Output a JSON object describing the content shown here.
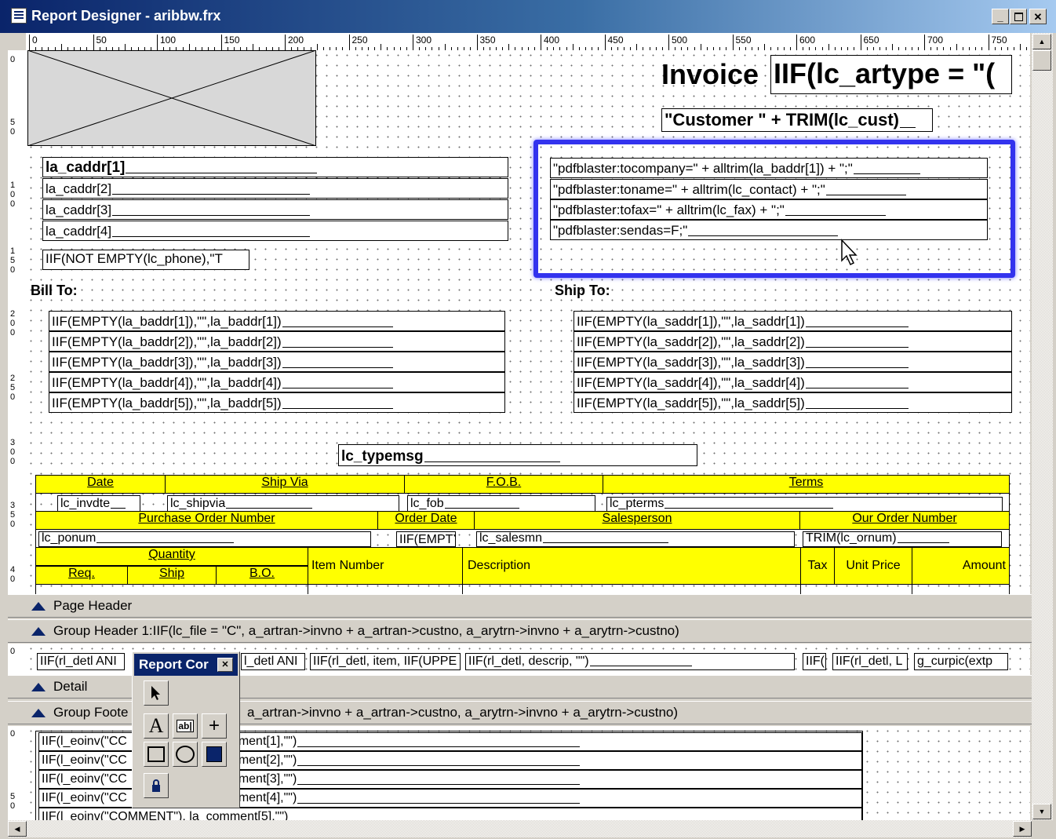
{
  "window": {
    "title": "Report Designer - aribbw.frx"
  },
  "ruler": {
    "labels": [
      "0",
      "50",
      "100",
      "150",
      "200",
      "250",
      "300",
      "350",
      "400",
      "450",
      "500",
      "550",
      "600",
      "650",
      "700",
      "750"
    ]
  },
  "header": {
    "invoice_label": "Invoice",
    "invoice_expr": "IIF(lc_artype = \"(",
    "customer_expr": "\"Customer \" + TRIM(lc_cust)"
  },
  "company_addr": [
    "la_caddr[1]",
    "la_caddr[2]",
    "la_caddr[3]",
    "la_caddr[4]"
  ],
  "phone_expr": "IIF(NOT EMPTY(lc_phone),\"T",
  "pdf_fields": [
    "\"pdfblaster:tocompany=\" + alltrim(la_baddr[1]) + \";\"",
    "\"pdfblaster:toname=\" + alltrim(lc_contact) + \";\"",
    "\"pdfblaster:tofax=\" + alltrim(lc_fax) + \";\"",
    "\"pdfblaster:sendas=F;\""
  ],
  "bill_to": {
    "label": "Bill To:",
    "lines": [
      "IIF(EMPTY(la_baddr[1]),\"\",la_baddr[1])",
      "IIF(EMPTY(la_baddr[2]),\"\",la_baddr[2])",
      "IIF(EMPTY(la_baddr[3]),\"\",la_baddr[3])",
      "IIF(EMPTY(la_baddr[4]),\"\",la_baddr[4])",
      "IIF(EMPTY(la_baddr[5]),\"\",la_baddr[5])"
    ]
  },
  "ship_to": {
    "label": "Ship To:",
    "lines": [
      "IIF(EMPTY(la_saddr[1]),\"\",la_saddr[1])",
      "IIF(EMPTY(la_saddr[2]),\"\",la_saddr[2])",
      "IIF(EMPTY(la_saddr[3]),\"\",la_saddr[3])",
      "IIF(EMPTY(la_saddr[4]),\"\",la_saddr[4])",
      "IIF(EMPTY(la_saddr[5]),\"\",la_saddr[5])"
    ]
  },
  "typemsg": "lc_typemsg",
  "grid": {
    "row1": {
      "date": "Date",
      "ship_via": "Ship Via",
      "fob": "F.O.B.",
      "terms": "Terms"
    },
    "row1_vals": {
      "date": "lc_invdte",
      "ship_via": "lc_shipvia",
      "fob": "lc_fob",
      "terms": "lc_pterms"
    },
    "row2": {
      "po": "Purchase Order Number",
      "order_date": "Order Date",
      "salesperson": "Salesperson",
      "our_order": "Our Order Number"
    },
    "row2_vals": {
      "po": "lc_ponum",
      "order_date": "IIF(EMPTY",
      "salesperson": "lc_salesmn",
      "our_order": "TRIM(lc_ornum)"
    },
    "row3": {
      "quantity": "Quantity",
      "req": "Req.",
      "ship": "Ship",
      "bo": "B.O.",
      "item": "Item Number",
      "desc": "Description",
      "tax": "Tax",
      "unit_price": "Unit Price",
      "amount": "Amount"
    }
  },
  "bands": {
    "page_header": "Page Header",
    "group_header": "Group Header 1:IIF(lc_file = \"C\", a_artran->invno + a_artran->custno, a_arytrn->invno + a_arytrn->custno)",
    "detail": "Detail",
    "group_footer_a": "Group Foote",
    "group_footer_b": "a_artran->invno + a_artran->custno, a_arytrn->invno + a_arytrn->custno)"
  },
  "detail_fields": [
    "IIF(rl_detl ANI",
    "l_detl ANI",
    "IIF(rl_detl, item, IIF(UPPE",
    "IIF(rl_detl, descrip, \"\")",
    "IIF(",
    "IIF(rl_detl, L",
    "g_curpic(extp"
  ],
  "footer_left": [
    "IIF(l_eoinv(\"CC",
    "IIF(l_eoinv(\"CC",
    "IIF(l_eoinv(\"CC",
    "IIF(l_eoinv(\"CC",
    "IIF(l_eoinv(\"COMMENT\"), la_comment[5],\"\")"
  ],
  "footer_right": [
    "ment[1],\"\")",
    "ment[2],\"\")",
    "ment[3],\"\")",
    "ment[4],\"\")"
  ],
  "toolbox": {
    "title": "Report Cor"
  }
}
